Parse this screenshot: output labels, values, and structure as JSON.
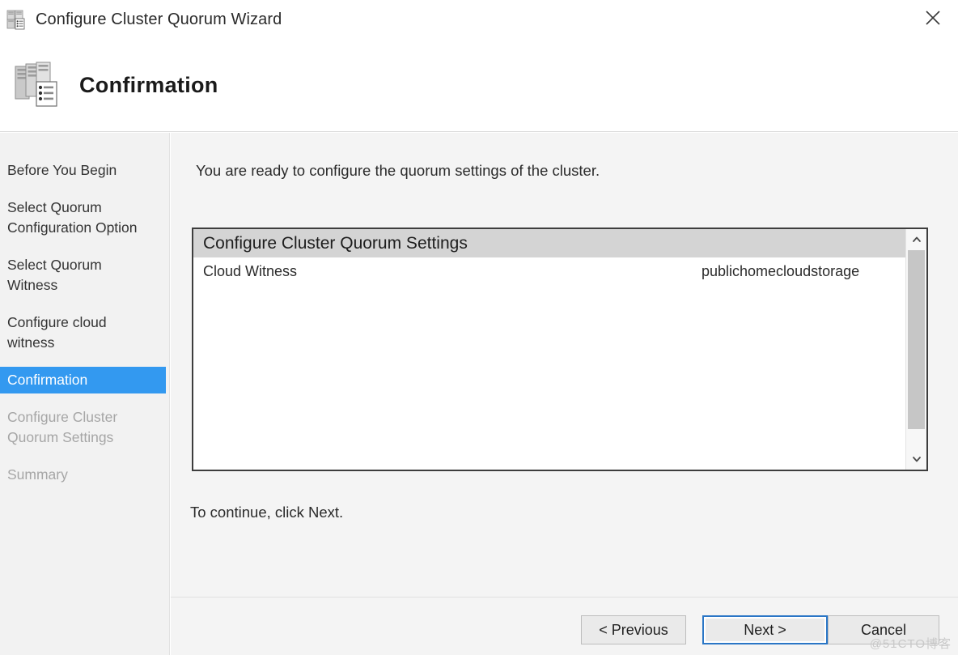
{
  "window": {
    "title": "Configure Cluster Quorum Wizard",
    "icon": "cluster-servers-icon",
    "close_label": "close-icon"
  },
  "banner": {
    "title": "Confirmation",
    "icon": "cluster-servers-checklist-icon"
  },
  "sidebar": {
    "items": [
      {
        "label": "Before You Begin",
        "state": "done"
      },
      {
        "label": "Select Quorum\nConfiguration Option",
        "state": "done"
      },
      {
        "label": "Select Quorum\nWitness",
        "state": "done"
      },
      {
        "label": "Configure cloud\nwitness",
        "state": "done"
      },
      {
        "label": "Confirmation",
        "state": "active"
      },
      {
        "label": "Configure Cluster\nQuorum Settings",
        "state": "disabled"
      },
      {
        "label": "Summary",
        "state": "disabled"
      }
    ]
  },
  "main": {
    "intro_text": "You are ready to configure the quorum settings of the cluster.",
    "outro_text": "To continue, click Next.",
    "listbox": {
      "header": "Configure Cluster Quorum Settings",
      "rows": [
        {
          "key": "Cloud Witness",
          "value": "publichomecloudstorage"
        }
      ],
      "scrollbar": {
        "up_arrow": "chevron-up-icon",
        "down_arrow": "chevron-down-icon"
      }
    }
  },
  "footer": {
    "previous_label": "< Previous",
    "next_label": "Next >",
    "cancel_label": "Cancel"
  },
  "watermark": {
    "text": "@51CTO博客"
  },
  "colors": {
    "accent": "#3399f0",
    "focus_border": "#2a76c6",
    "sidebar_bg": "#f2f2f2",
    "content_bg": "#f4f4f4",
    "listbox_header_bg": "#d4d4d4"
  }
}
